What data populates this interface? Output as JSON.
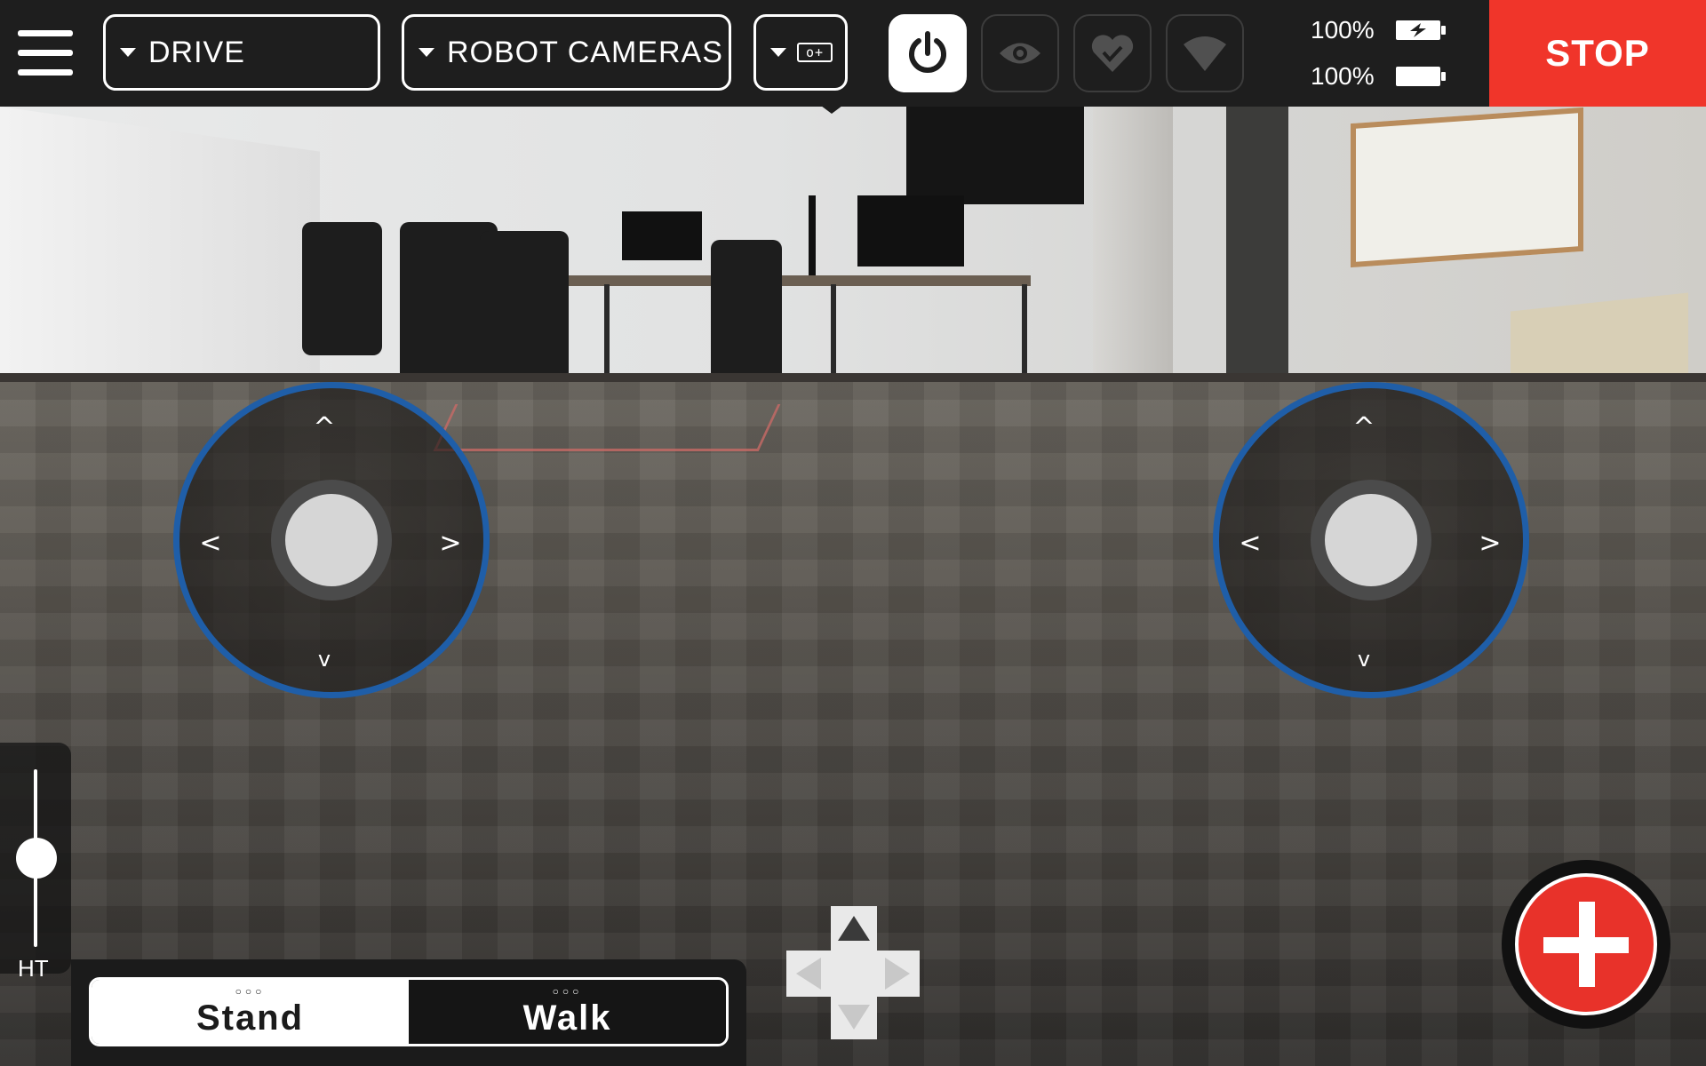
{
  "topbar": {
    "mode_dropdown": "DRIVE",
    "camera_dropdown": "ROBOT CAMERAS",
    "camera_layout_icon": "o+",
    "battery_1": "100%",
    "battery_2": "100%",
    "stop_label": "STOP",
    "icons": [
      "menu-icon",
      "power-icon",
      "eye-icon",
      "heart-icon",
      "wifi-icon",
      "battery-charging-icon",
      "battery-icon"
    ]
  },
  "left_joystick": {
    "up": "^",
    "down": "v",
    "left": "<",
    "right": ">"
  },
  "right_joystick": {
    "up": "^",
    "down": "v",
    "left": "<",
    "right": ">"
  },
  "height_slider": {
    "label": "HT",
    "level": 0.5
  },
  "mode_toggle": {
    "stand": "Stand",
    "walk": "Walk",
    "dots": "○○○",
    "selected": "Stand"
  },
  "colors": {
    "stop": "#f0352a",
    "joystick_ring": "#1f5ea8",
    "add_button": "#e8322a"
  }
}
